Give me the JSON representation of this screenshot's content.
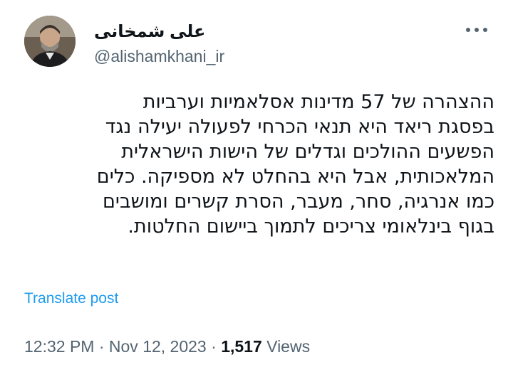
{
  "author": {
    "display_name": "علی شمخانی",
    "handle": "@alishamkhani_ir"
  },
  "post": {
    "lines": [
      "ההצהרה של 57 מדינות אסלאמיות וערביות",
      "בפסגת ריאד היא תנאי הכרחי לפעולה יעילה נגד",
      "הפשעים ההולכים וגדלים של הישות הישראלית",
      "המלאכותית, אבל היא בהחלט לא מספיקה. כלים",
      "כמו אנרגיה, סחר, מעבר, הסרת קשרים ומושבים",
      "בגוף בינלאומי צריכים לתמוך ביישום החלטות."
    ],
    "translate_label": "Translate post"
  },
  "meta": {
    "time": "12:32 PM",
    "sep1": " · ",
    "date": "Nov 12, 2023",
    "sep2": " · ",
    "views_count": "1,517",
    "views_label": " Views"
  },
  "colors": {
    "link": "#1d9bf0",
    "secondary_text": "#536471",
    "primary_text": "#0f1419"
  },
  "icons": {
    "more": "more-horizontal-icon"
  }
}
